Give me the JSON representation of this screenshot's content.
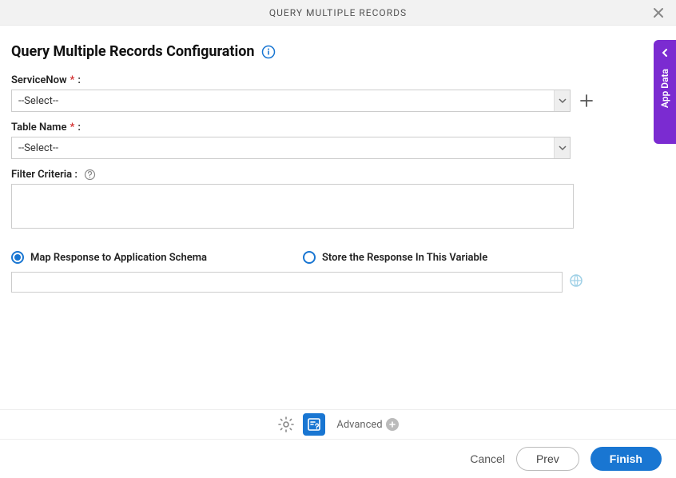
{
  "header": {
    "title": "QUERY MULTIPLE RECORDS"
  },
  "page_title": "Query Multiple Records Configuration",
  "fields": {
    "servicenow": {
      "label": "ServiceNow",
      "value": "--Select--"
    },
    "table_name": {
      "label": "Table Name",
      "value": "--Select--"
    },
    "filter_criteria": {
      "label": "Filter Criteria :",
      "value": ""
    }
  },
  "response_options": {
    "map_schema": "Map Response to Application Schema",
    "store_variable": "Store the Response In This Variable",
    "selected": "map_schema",
    "value": ""
  },
  "side_tab": {
    "label": "App Data"
  },
  "toolbar": {
    "advanced_label": "Advanced"
  },
  "footer": {
    "cancel": "Cancel",
    "prev": "Prev",
    "finish": "Finish"
  }
}
